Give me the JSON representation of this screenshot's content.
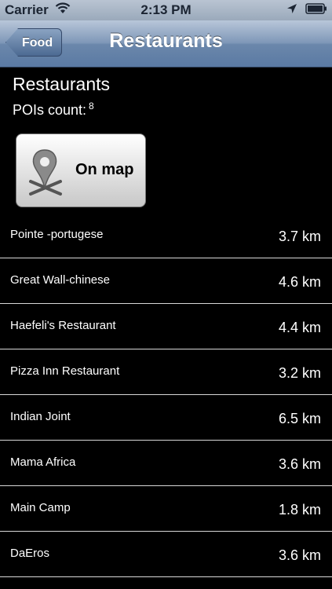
{
  "status_bar": {
    "carrier": "Carrier",
    "time": "2:13 PM"
  },
  "nav": {
    "back_label": "Food",
    "title": "Restaurants"
  },
  "header": {
    "title": "Restaurants",
    "poi_label": "POIs count:",
    "poi_count": "8",
    "map_button_label": "On map"
  },
  "places": [
    {
      "name": "Pointe -portugese",
      "distance": "3.7 km"
    },
    {
      "name": "Great Wall-chinese",
      "distance": "4.6 km"
    },
    {
      "name": "Haefeli's Restaurant",
      "distance": "4.4 km"
    },
    {
      "name": "Pizza Inn Restaurant",
      "distance": "3.2 km"
    },
    {
      "name": "Indian Joint",
      "distance": "6.5 km"
    },
    {
      "name": "Mama Africa",
      "distance": "3.6 km"
    },
    {
      "name": "Main Camp",
      "distance": "1.8 km"
    },
    {
      "name": "DaEros",
      "distance": "3.6 km"
    }
  ],
  "colors": {
    "background": "#000000",
    "nav_bar": "#6b87ab",
    "separator": "#d8d8d8"
  },
  "icons": [
    "wifi-icon",
    "location-arrow-icon",
    "battery-icon",
    "map-pin-icon"
  ]
}
